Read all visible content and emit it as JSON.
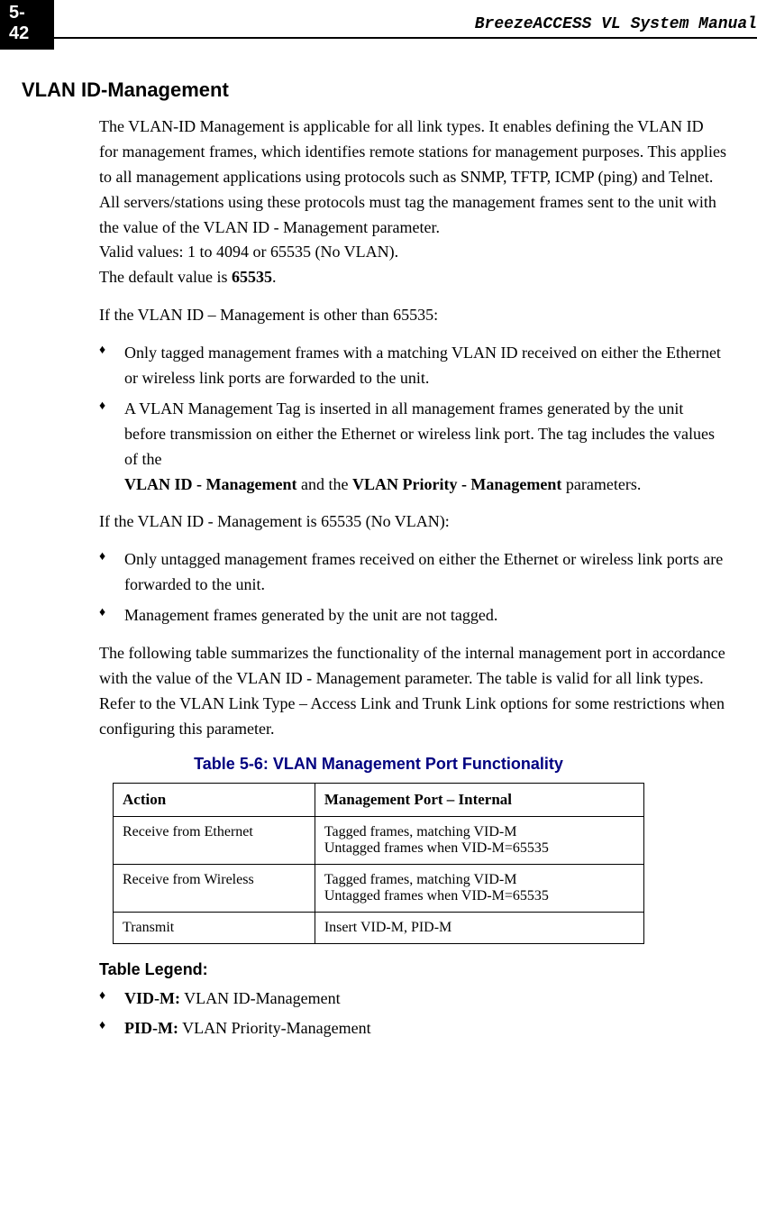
{
  "page_number": "5-42",
  "header_title": "BreezeACCESS VL System Manual",
  "section_heading": "VLAN ID-Management",
  "para1": {
    "text1": "The VLAN-ID Management is applicable for all link types. It enables defining the VLAN ID for management frames, which identifies remote stations for management purposes. This applies to all management applications using protocols such as SNMP, TFTP, ICMP (ping) and Telnet. All servers/stations using these protocols must tag the management frames sent to the unit with the value of the VLAN ID - Management parameter.",
    "text2": "Valid values: 1 to 4094 or 65535 (No VLAN).",
    "text3_pre": "The default value is ",
    "text3_bold": "65535",
    "text3_post": "."
  },
  "para2": "If the VLAN ID – Management is other than 65535:",
  "bullets1": {
    "b1": "Only tagged management frames with a matching VLAN ID received on either the Ethernet or wireless link ports are forwarded to the unit.",
    "b2_pre": "A VLAN Management Tag is inserted in all management frames generated by the unit before transmission on either the Ethernet or wireless link port. The tag includes the values of the ",
    "b2_bold1": "VLAN ID - Management",
    "b2_mid": " and the ",
    "b2_bold2": "VLAN Priority - Management",
    "b2_post": " parameters."
  },
  "para3": "If the VLAN ID - Management is 65535 (No VLAN):",
  "bullets2": {
    "b1": "Only untagged management frames received on either the Ethernet or wireless link ports are forwarded to the unit.",
    "b2": "Management frames generated by the unit are not tagged."
  },
  "para4": "The following table summarizes the functionality of the internal management port in accordance with the value of the VLAN ID - Management parameter. The table is valid for all link types. Refer to the VLAN Link Type – Access Link and Trunk Link options for some restrictions when configuring this parameter.",
  "table": {
    "caption": "Table 5-6: VLAN Management Port Functionality",
    "headers": {
      "h1": "Action",
      "h2": "Management Port – Internal"
    },
    "rows": {
      "r1c1": "Receive from Ethernet",
      "r1c2a": "Tagged frames, matching VID-M",
      "r1c2b": "Untagged frames when VID-M=65535",
      "r2c1": "Receive from Wireless",
      "r2c2a": "Tagged frames, matching VID-M",
      "r2c2b": "Untagged frames when VID-M=65535",
      "r3c1": "Transmit",
      "r3c2": "Insert VID-M, PID-M"
    }
  },
  "legend": {
    "heading": "Table Legend:",
    "l1_bold": "VID-M:",
    "l1_text": " VLAN ID-Management",
    "l2_bold": "PID-M:",
    "l2_text": " VLAN Priority-Management"
  },
  "chart_data": {
    "type": "table",
    "title": "Table 5-6: VLAN Management Port Functionality",
    "headers": [
      "Action",
      "Management Port – Internal"
    ],
    "rows": [
      [
        "Receive from Ethernet",
        "Tagged frames, matching VID-M; Untagged frames when VID-M=65535"
      ],
      [
        "Receive from Wireless",
        "Tagged frames, matching VID-M; Untagged frames when VID-M=65535"
      ],
      [
        "Transmit",
        "Insert VID-M, PID-M"
      ]
    ]
  }
}
